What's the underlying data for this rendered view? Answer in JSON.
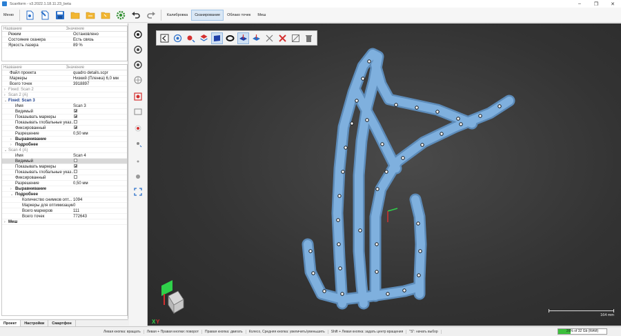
{
  "window": {
    "title": "Scanform - v3.2022.1.18.11.23_beta"
  },
  "toolbar": {
    "menu_label": "Меню",
    "tabs": [
      "Калибровка",
      "Сканирование",
      "Облако точек",
      "Меш"
    ],
    "active_tab": 1
  },
  "device_table": {
    "header": {
      "name": "Название",
      "value": "Значение"
    },
    "rows": [
      {
        "name": "Режим",
        "value": "Остановлено"
      },
      {
        "name": "Состояние сканера",
        "value": "Есть связь"
      },
      {
        "name": "Яркость лазера",
        "value": "89 %"
      }
    ]
  },
  "project_table": {
    "header": {
      "name": "Название",
      "value": "Значение"
    },
    "file_label": "Файл проекта",
    "file_value": "quadro details.scpr",
    "markers_label": "Маркеры",
    "markers_value": "Низкий (Пленка) 6,0 мм",
    "points_label": "Всего точек",
    "points_value": "3918897",
    "fixed2_label": "Fixed: Scan 2",
    "scan2_label": "Scan 2 (A)",
    "fixed3_label": "Fixed: Scan 3",
    "s3_name_label": "Имя",
    "s3_name_value": "Scan 3",
    "visible_label": "Видимый",
    "show_markers_label": "Показывать маркеры",
    "show_global_label": "Показывать глобальные указ...",
    "fixed_label": "Фиксированный",
    "resolution_label": "Разрешение",
    "s3_resolution_value": "0,50 мм",
    "align_label": "Выравнивание",
    "details_label": "Подробнее",
    "scan4_label": "Scan 4 (A)",
    "s4_name_value": "Scan 4",
    "s4_resolution_value": "0,50 мм",
    "opt_shots_label": "Количество снимков опт...",
    "opt_shots_value": "1094",
    "opt_markers_label": "Маркеры для оптимизации",
    "opt_markers_value": "0",
    "total_markers_label": "Всего маркеров",
    "total_markers_value": "111",
    "total_points_label": "Всего точек",
    "total_points_value": "772643",
    "mesh_label": "Меш"
  },
  "bottom_tabs": [
    "Проект",
    "Настройки",
    "Смартфон"
  ],
  "viewport": {
    "scale_label": "164 mm",
    "axis_y": "Y",
    "axis_x": "X",
    "model_color": "#7fb0de",
    "marker_color": "#ffffff"
  },
  "statusbar": {
    "hints": [
      "Левая кнопка: вращать",
      "Левая + Правая кнопки: поворот",
      "Правая кнопка: двигать",
      "Колесо, Средняя кнопка: увеличить/уменьшить",
      "Shift + Левая кнопка: задать центр вращения",
      "\"S\": начать выбор"
    ],
    "ram_label": "26% of 32 Gb (RAM)",
    "ram_fraction": 0.26
  }
}
